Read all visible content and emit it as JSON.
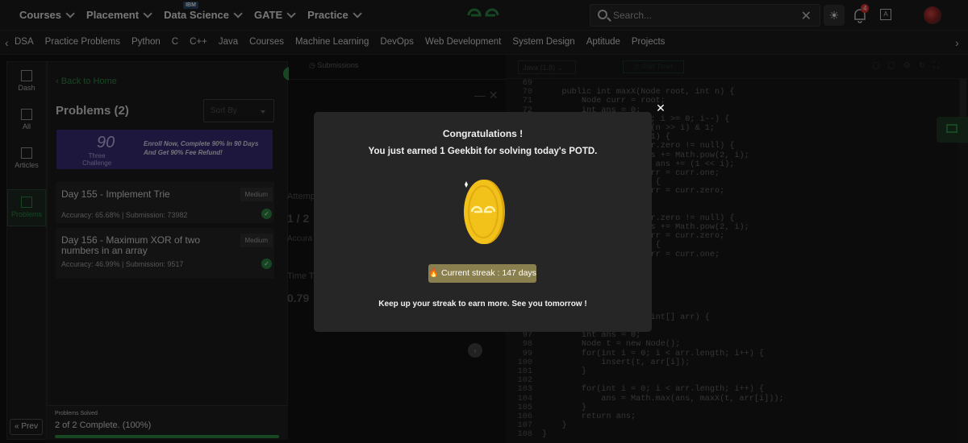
{
  "topnav": {
    "items": [
      {
        "label": "Courses"
      },
      {
        "label": "Placement"
      },
      {
        "label": "Data Science",
        "badge": "IBM"
      },
      {
        "label": "GATE"
      },
      {
        "label": "Practice"
      }
    ],
    "search_placeholder": "Search...",
    "notification_count": "4",
    "lang_icon": "translate-icon"
  },
  "subnav": {
    "links": [
      "DSA",
      "Practice Problems",
      "Python",
      "C",
      "C++",
      "Java",
      "Courses",
      "Machine Learning",
      "DevOps",
      "Web Development",
      "System Design",
      "Aptitude",
      "Projects"
    ]
  },
  "rail": {
    "items": [
      {
        "label": "Dash",
        "icon": "dashboard-icon"
      },
      {
        "label": "All",
        "icon": "grid-icon"
      },
      {
        "label": "Articles",
        "icon": "book-icon"
      },
      {
        "label": "Problems",
        "icon": "code-icon",
        "active": true
      }
    ],
    "prev_label": "Prev"
  },
  "panel": {
    "back_label": "Back to Home",
    "title": "Problems (2)",
    "sort_label": "Sort By",
    "banner": {
      "logo_top": "Three",
      "logo_num": "90",
      "logo_bottom": "Challenge",
      "text": "Enroll Now, Complete 90% In 90 Days And Get 90% Fee Refund!"
    },
    "problems": [
      {
        "title": "Day 155 - Implement Trie",
        "level": "Medium",
        "meta": "Accuracy: 65.68% | Submission: 73982"
      },
      {
        "title": "Day 156 - Maximum XOR of two numbers in an array",
        "level": "Medium",
        "meta": "Accuracy: 46.99% | Submission: 9517"
      }
    ],
    "solved_header": "Problems Solved",
    "solved_text": "2 of 2 Complete. (100%)",
    "solved_progress": 1.0
  },
  "middle": {
    "tab": "Submissions",
    "attempts_label": "Attemp",
    "attempts_value": "1 / 2",
    "accuracy_label": "Accura",
    "time_label": "Time Ta",
    "time_value": "0.79"
  },
  "editor": {
    "language": "Java (1.8)",
    "timer_label": "Start Timer",
    "lines": [
      {
        "n": "69",
        "t": ""
      },
      {
        "n": "70",
        "t": "    public int maxX(Node root, int n) {"
      },
      {
        "n": "71",
        "t": "        Node curr = root;"
      },
      {
        "n": "72",
        "t": "        int ans = 0;"
      },
      {
        "n": "73",
        "t": "        for(int i = 31; i >= 0; i--) {"
      },
      {
        "n": "74",
        "t": "            int bit = (n >> i) & 1;"
      },
      {
        "n": "75",
        "t": "            if(bit == 1) {"
      },
      {
        "n": "76",
        "t": "                if(curr.zero != null) {"
      },
      {
        "n": "77",
        "t": "                    ans += Math.pow(2, i);"
      },
      {
        "n": "78",
        "t": "                    // ans += (1 << i);"
      },
      {
        "n": "79",
        "t": "                    curr = curr.one;"
      },
      {
        "n": "80",
        "t": "                } else {"
      },
      {
        "n": "81",
        "t": "                    curr = curr.zero;"
      },
      {
        "n": "82",
        "t": "                }"
      },
      {
        "n": "83",
        "t": "            } else {"
      },
      {
        "n": "84",
        "t": "                if(curr.zero != null) {"
      },
      {
        "n": "85",
        "t": "                    ans += Math.pow(2, i);"
      },
      {
        "n": "86",
        "t": "                    curr = curr.zero;"
      },
      {
        "n": "87",
        "t": "                } else {"
      },
      {
        "n": "88",
        "t": "                    curr = curr.one;"
      },
      {
        "n": "89",
        "t": "                }"
      },
      {
        "n": "90",
        "t": "            }"
      },
      {
        "n": "91",
        "t": "        }"
      },
      {
        "n": "92",
        "t": "        return ans;"
      },
      {
        "n": "93",
        "t": "    }"
      },
      {
        "n": "94",
        "t": ""
      },
      {
        "n": "95",
        "t": "    int maxXor(int n, int[] arr) {"
      },
      {
        "n": "96",
        "t": "        // code here"
      },
      {
        "n": "97",
        "t": "        int ans = 0;"
      },
      {
        "n": "98",
        "t": "        Node t = new Node();"
      },
      {
        "n": "99",
        "t": "        for(int i = 0; i < arr.length; i++) {"
      },
      {
        "n": "100",
        "t": "            insert(t, arr[i]);"
      },
      {
        "n": "101",
        "t": "        }"
      },
      {
        "n": "102",
        "t": ""
      },
      {
        "n": "103",
        "t": "        for(int i = 0; i < arr.length; i++) {"
      },
      {
        "n": "104",
        "t": "            ans = Math.max(ans, maxX(t, arr[i]));"
      },
      {
        "n": "105",
        "t": "        }"
      },
      {
        "n": "106",
        "t": "        return ans;"
      },
      {
        "n": "107",
        "t": "    }"
      },
      {
        "n": "108",
        "t": "}"
      }
    ]
  },
  "modal": {
    "title": "Congratulations !",
    "message": "You just earned 1 Geekbit for solving today's POTD.",
    "streak": "Current streak : 147 days",
    "footer": "Keep up your streak to earn more. See you tomorrow !"
  },
  "colors": {
    "brand_green": "#2f8d46",
    "modal_bg": "#262626",
    "streak_bg": "#8a7f4e",
    "coin": "#f2c21a"
  }
}
